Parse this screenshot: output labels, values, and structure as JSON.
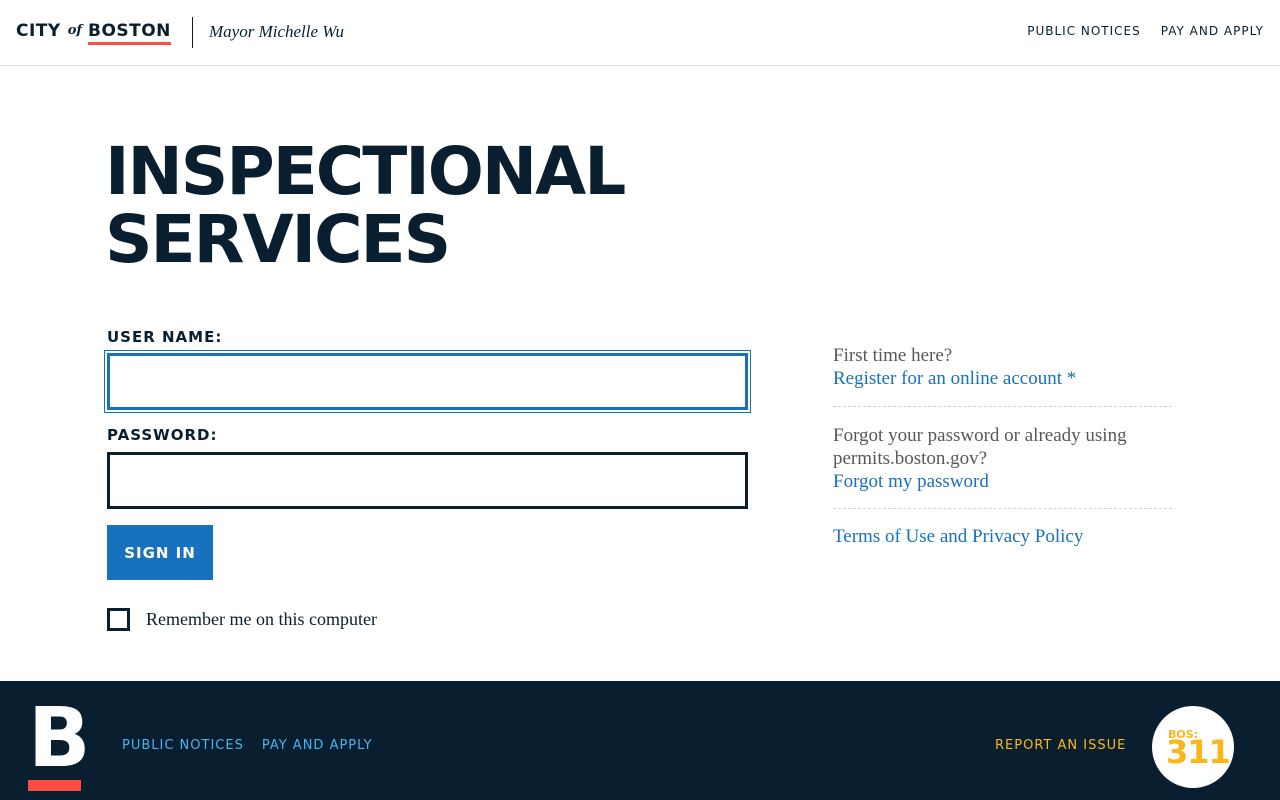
{
  "header": {
    "logo_city": "CITY",
    "logo_of": "of",
    "logo_boston": "BOSTON",
    "mayor": "Mayor Michelle Wu",
    "nav": [
      "PUBLIC NOTICES",
      "PAY AND APPLY"
    ]
  },
  "main": {
    "title": "INSPECTIONAL SERVICES",
    "username_label": "USER NAME:",
    "username_value": "",
    "password_label": "PASSWORD:",
    "password_value": "",
    "signin_label": "SIGN IN",
    "remember_label": "Remember me on this computer",
    "remember_checked": false
  },
  "help": {
    "first_time": "First time here?",
    "register_link": "Register for an online account *",
    "forgot_text": "Forgot your password or already using permits.boston.gov?",
    "forgot_link": "Forgot my password",
    "terms_link": "Terms of Use and Privacy Policy"
  },
  "footer": {
    "logo_letter": "B",
    "nav": [
      "PUBLIC NOTICES",
      "PAY AND APPLY"
    ],
    "report": "REPORT AN ISSUE",
    "bos_label": "BOS:",
    "bos_number": "311"
  },
  "colors": {
    "navy": "#091f2f",
    "blue": "#1871bd",
    "red": "#fb4d42",
    "yellow": "#fcb61a",
    "light_blue": "#45b4f0"
  }
}
